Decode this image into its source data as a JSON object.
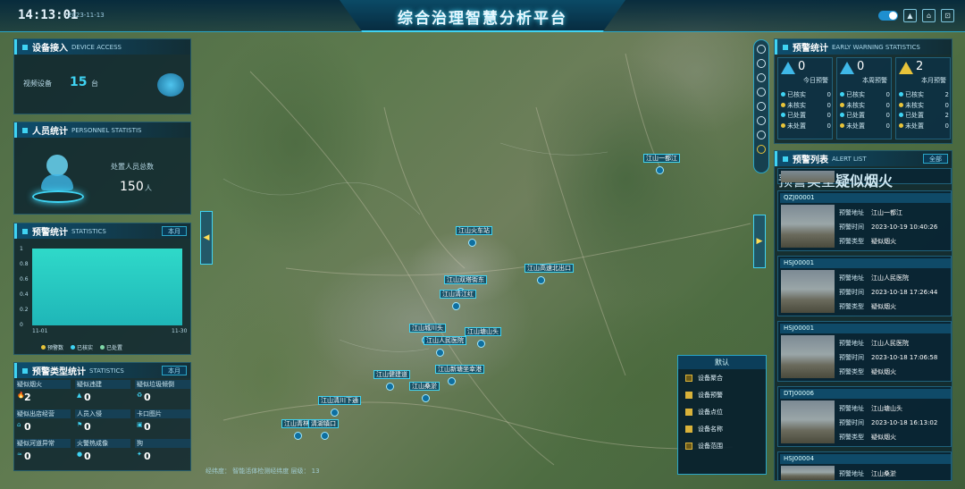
{
  "header": {
    "time": "14:13:01",
    "date": "2023-11-13",
    "title": "综合治理智慧分析平台"
  },
  "device": {
    "title": "设备接入",
    "title_en": "DEVICE ACCESS",
    "label": "视频设备",
    "count": "15",
    "unit": "台"
  },
  "personnel": {
    "title": "人员统计",
    "title_en": "PERSONNEL STATISTIS",
    "label": "处置人员总数",
    "count": "150",
    "unit": "人"
  },
  "warn_stats": {
    "title": "预警统计",
    "title_en": "STATISTICS",
    "selector": "本月",
    "legend": [
      "预警数",
      "已核实",
      "已处置"
    ],
    "x_start": "11-01",
    "x_end": "11-30",
    "y_ticks": [
      "1",
      "0.8",
      "0.6",
      "0.4",
      "0.2",
      "0"
    ]
  },
  "warn_type": {
    "title": "预警类型统计",
    "title_en": "STATISTICS",
    "selector": "本月",
    "items": [
      {
        "label": "疑似烟火",
        "value": "2"
      },
      {
        "label": "疑似违建",
        "value": "0"
      },
      {
        "label": "疑似垃圾倾倒",
        "value": "0"
      },
      {
        "label": "疑似出店经营",
        "value": "0"
      },
      {
        "label": "人员入侵",
        "value": "0"
      },
      {
        "label": "卡口图片",
        "value": "0"
      },
      {
        "label": "疑似河道异常",
        "value": "0"
      },
      {
        "label": "火警热成像",
        "value": "0"
      },
      {
        "label": "狗",
        "value": "0"
      }
    ]
  },
  "early_warning": {
    "title": "预警统计",
    "title_en": "EARLY WARNING STATISTICS",
    "cards": [
      {
        "count": "0",
        "label": "今日预警",
        "rows": [
          [
            "已核实",
            "0"
          ],
          [
            "未核实",
            "0"
          ],
          [
            "已处置",
            "0"
          ],
          [
            "未处置",
            "0"
          ]
        ]
      },
      {
        "count": "0",
        "label": "本周预警",
        "rows": [
          [
            "已核实",
            "0"
          ],
          [
            "未核实",
            "0"
          ],
          [
            "已处置",
            "0"
          ],
          [
            "未处置",
            "0"
          ]
        ]
      },
      {
        "count": "2",
        "label": "本月预警",
        "rows": [
          [
            "已核实",
            "2"
          ],
          [
            "未核实",
            "0"
          ],
          [
            "已处置",
            "2"
          ],
          [
            "未处置",
            "0"
          ]
        ]
      }
    ]
  },
  "alert_list": {
    "title": "预警列表",
    "title_en": "ALERT LIST",
    "selector": "全部",
    "top_partial": {
      "k": "预警类型",
      "v": "疑似烟火"
    },
    "items": [
      {
        "code": "QZJ00001",
        "addr": "江山一都江",
        "time": "2023-10-19 10:40:26",
        "type": "疑似烟火"
      },
      {
        "code": "HSJ00001",
        "addr": "江山人民医院",
        "time": "2023-10-18 17:26:44",
        "type": "疑似烟火"
      },
      {
        "code": "HSJ00001",
        "addr": "江山人民医院",
        "time": "2023-10-18 17:06:58",
        "type": "疑似烟火"
      },
      {
        "code": "DTJ00006",
        "addr": "江山塘山头",
        "time": "2023-10-18 16:13:02",
        "type": "疑似烟火"
      },
      {
        "code": "HSJ00004",
        "addr": "江山桑淤",
        "time": "",
        "type": ""
      }
    ],
    "k_addr": "预警地址",
    "k_time": "预警时间",
    "k_type": "预警类型"
  },
  "map": {
    "markers": [
      "江山一都江",
      "江山火车站",
      "江山高速北出口",
      "江山双塔街东",
      "江山清江红",
      "江山城川头",
      "江山塘山头",
      "江山人民医院",
      "江山健建道",
      "江山新塘坐幸港",
      "江山桑淤",
      "江山清川下通",
      "江山青林",
      "清湖镇口"
    ],
    "footer": "经纬度：  智能活体检测经纬度    层级：  13"
  },
  "legend_panel": {
    "title": "默认",
    "items": [
      {
        "label": "设备聚合",
        "checked": false
      },
      {
        "label": "设备预警",
        "checked": true
      },
      {
        "label": "设备点位",
        "checked": true
      },
      {
        "label": "设备名称",
        "checked": true
      },
      {
        "label": "设备范围",
        "checked": false
      }
    ]
  },
  "colors": {
    "accent": "#3fd3f3",
    "bar_fill": "#2fd9c9",
    "dot_verified": "#3fd3f3",
    "dot_unverified": "#e8c43a"
  }
}
